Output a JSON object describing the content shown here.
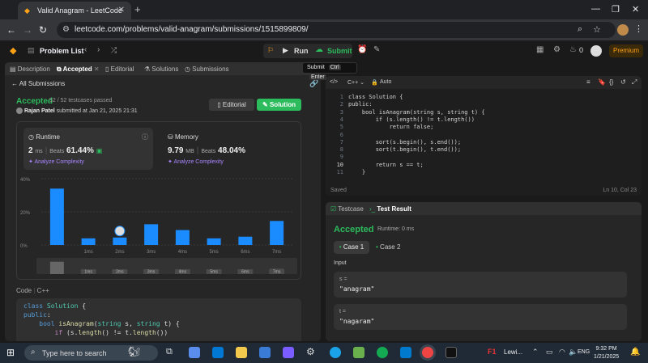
{
  "browser": {
    "tab_title": "Valid Anagram - LeetCode",
    "url": "leetcode.com/problems/valid-anagram/submissions/1515899809/"
  },
  "nav": {
    "problem_list": "Problem List",
    "run": "Run",
    "submit": "Submit",
    "count": "0",
    "premium": "Premium"
  },
  "tooltip": {
    "label": "Submit",
    "key1": "Ctrl",
    "key2": "Enter"
  },
  "left_tabs": [
    "Description",
    "Accepted",
    "Editorial",
    "Solutions",
    "Submissions"
  ],
  "submission": {
    "back": "All Submissions",
    "status": "Accepted",
    "passed": "52 / 52 testcases passed",
    "author": "Rajan Patel",
    "submitted_text": "submitted at Jan 21, 2025 21:31",
    "editorial_btn": "Editorial",
    "solution_btn": "Solution",
    "runtime_title": "Runtime",
    "runtime_value": "2",
    "runtime_unit": "ms",
    "runtime_beats_label": "Beats",
    "runtime_beats": "61.44%",
    "memory_title": "Memory",
    "memory_value": "9.79",
    "memory_unit": "MB",
    "memory_beats_label": "Beats",
    "memory_beats": "48.04%",
    "analyze": "Analyze Complexity",
    "code_label": "Code",
    "lang": "C++"
  },
  "chart_data": {
    "type": "bar",
    "categories": [
      "",
      "1ms",
      "2ms",
      "3ms",
      "4ms",
      "5ms",
      "6ms",
      "7ms"
    ],
    "values": [
      34,
      4,
      4.5,
      12.5,
      9,
      4,
      5,
      14.5
    ],
    "yticks": [
      "40%",
      "20%",
      "0%"
    ],
    "ylim": [
      0,
      40
    ],
    "highlight": "2ms",
    "bar_color": "#1a8cff",
    "grid": true
  },
  "code_preview": [
    "class Solution {",
    "public:",
    "    bool isAnagram(string s, string t) {",
    "        if (s.length() != t.length())"
  ],
  "editor": {
    "lang": "C++",
    "mode": "Auto",
    "lines": [
      "class Solution {",
      "public:",
      "    bool isAnagram(string s, string t) {",
      "        if (s.length() != t.length())",
      "            return false;",
      "",
      "        sort(s.begin(), s.end());",
      "        sort(t.begin(), t.end());",
      "",
      "        return s == t;",
      "    }"
    ],
    "line_numbers": [
      "1",
      "2",
      "3",
      "4",
      "5",
      "6",
      "7",
      "8",
      "9",
      "10",
      "11"
    ],
    "saved": "Saved",
    "position": "Ln 10, Col 23"
  },
  "result": {
    "tab1": "Testcase",
    "tab2": "Test Result",
    "status": "Accepted",
    "runtime": "Runtime: 0 ms",
    "case1": "Case 1",
    "case2": "Case 2",
    "input_label": "Input",
    "s_name": "s =",
    "s_value": "\"anagram\"",
    "t_name": "t =",
    "t_value": "\"nagaram\""
  },
  "taskbar": {
    "search": "Type here to search",
    "weather": "Lewi...",
    "lang": "ENG",
    "time": "9:32 PM",
    "date": "1/21/2025"
  },
  "colors": {
    "accent_green": "#2cbb5d",
    "brand_orange": "#ffa116",
    "bar_blue": "#1a8cff"
  }
}
